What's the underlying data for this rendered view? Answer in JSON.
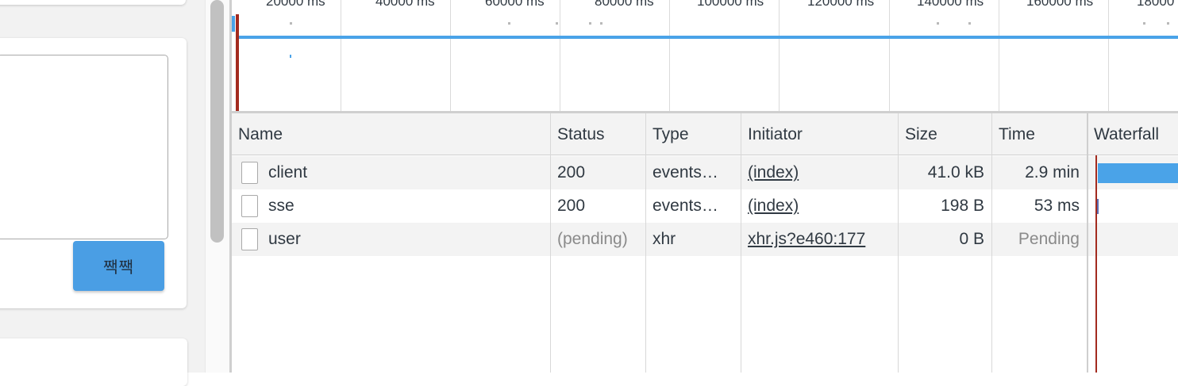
{
  "app": {
    "send_button_label": "짹짹"
  },
  "overview": {
    "time_labels": [
      "20000 ms",
      "40000 ms",
      "60000 ms",
      "80000 ms",
      "100000 ms",
      "120000 ms",
      "140000 ms",
      "160000 ms",
      "18000"
    ]
  },
  "network": {
    "columns": {
      "name": "Name",
      "status": "Status",
      "type": "Type",
      "initiator": "Initiator",
      "size": "Size",
      "time": "Time",
      "waterfall": "Waterfall"
    },
    "rows": [
      {
        "name": "client",
        "status": "200",
        "type": "events…",
        "initiator": "(index)",
        "size": "41.0 kB",
        "time": "2.9 min"
      },
      {
        "name": "sse",
        "status": "200",
        "type": "events…",
        "initiator": "(index)",
        "size": "198 B",
        "time": "53 ms"
      },
      {
        "name": "user",
        "status": "(pending)",
        "type": "xhr",
        "initiator": "xhr.js?e460:177",
        "size": "0 B",
        "time": "Pending"
      }
    ]
  },
  "colors": {
    "accent_blue": "#4aa3e8",
    "button_blue": "#4a9ee4",
    "marker_red": "#a32b1f"
  }
}
